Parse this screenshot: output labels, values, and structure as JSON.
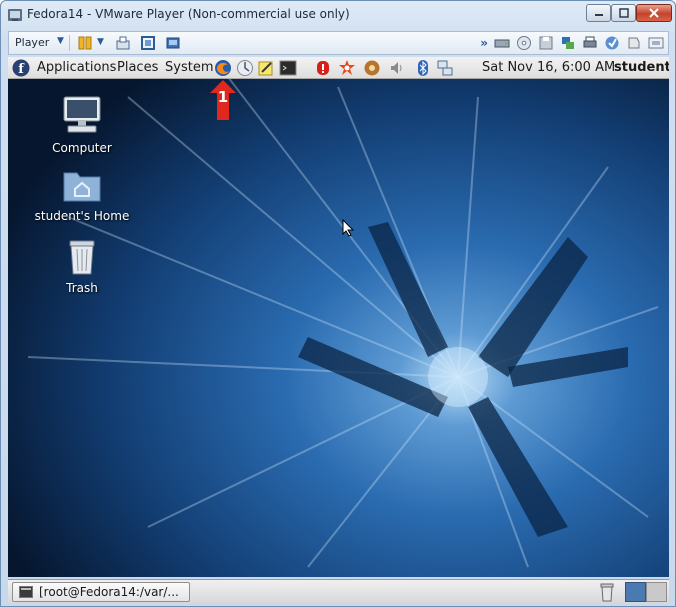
{
  "window": {
    "title": "Fedora14 - VMware Player (Non-commercial use only)",
    "controls": [
      "minimize-icon",
      "maximize-icon",
      "close-icon"
    ]
  },
  "vm_toolbar": {
    "player_label": "Player",
    "left_icons": [
      "pause-icon",
      "dropdown-arrow-icon",
      "send-ctrl-alt-del-icon",
      "fullscreen-icon",
      "unity-icon"
    ],
    "right_icons": [
      "more-chevron-icon",
      "hard-disk-icon",
      "cd-dvd-icon",
      "floppy-icon",
      "network-adapter-icon",
      "printer-icon",
      "sound-icon",
      "usb-icon",
      "display-icon"
    ]
  },
  "gnome_panel": {
    "menus": {
      "applications": "Applications",
      "places": "Places",
      "system": "System"
    },
    "launchers": [
      "firefox-icon",
      "evolution-icon",
      "notes-icon",
      "terminal-icon"
    ],
    "tray": [
      "alert-icon",
      "update-icon",
      "rhythmbox-icon",
      "volume-icon",
      "bluetooth-icon",
      "network-icon"
    ],
    "clock": "Sat Nov 16,  6:00 AM",
    "user": "student"
  },
  "annotation": {
    "label": "1",
    "color": "#e0281e"
  },
  "desktop": {
    "icons": [
      {
        "label": "Computer",
        "icon": "computer-icon"
      },
      {
        "label": "student's Home",
        "icon": "home-folder-icon"
      },
      {
        "label": "Trash",
        "icon": "trash-icon"
      }
    ]
  },
  "bottom_panel": {
    "task_label": "[root@Fedora14:/var/...",
    "workspaces": [
      "workspace-1",
      "workspace-2"
    ]
  },
  "colors": {
    "desktop_bg": "#0d2b52",
    "accent": "#4b79b2"
  }
}
